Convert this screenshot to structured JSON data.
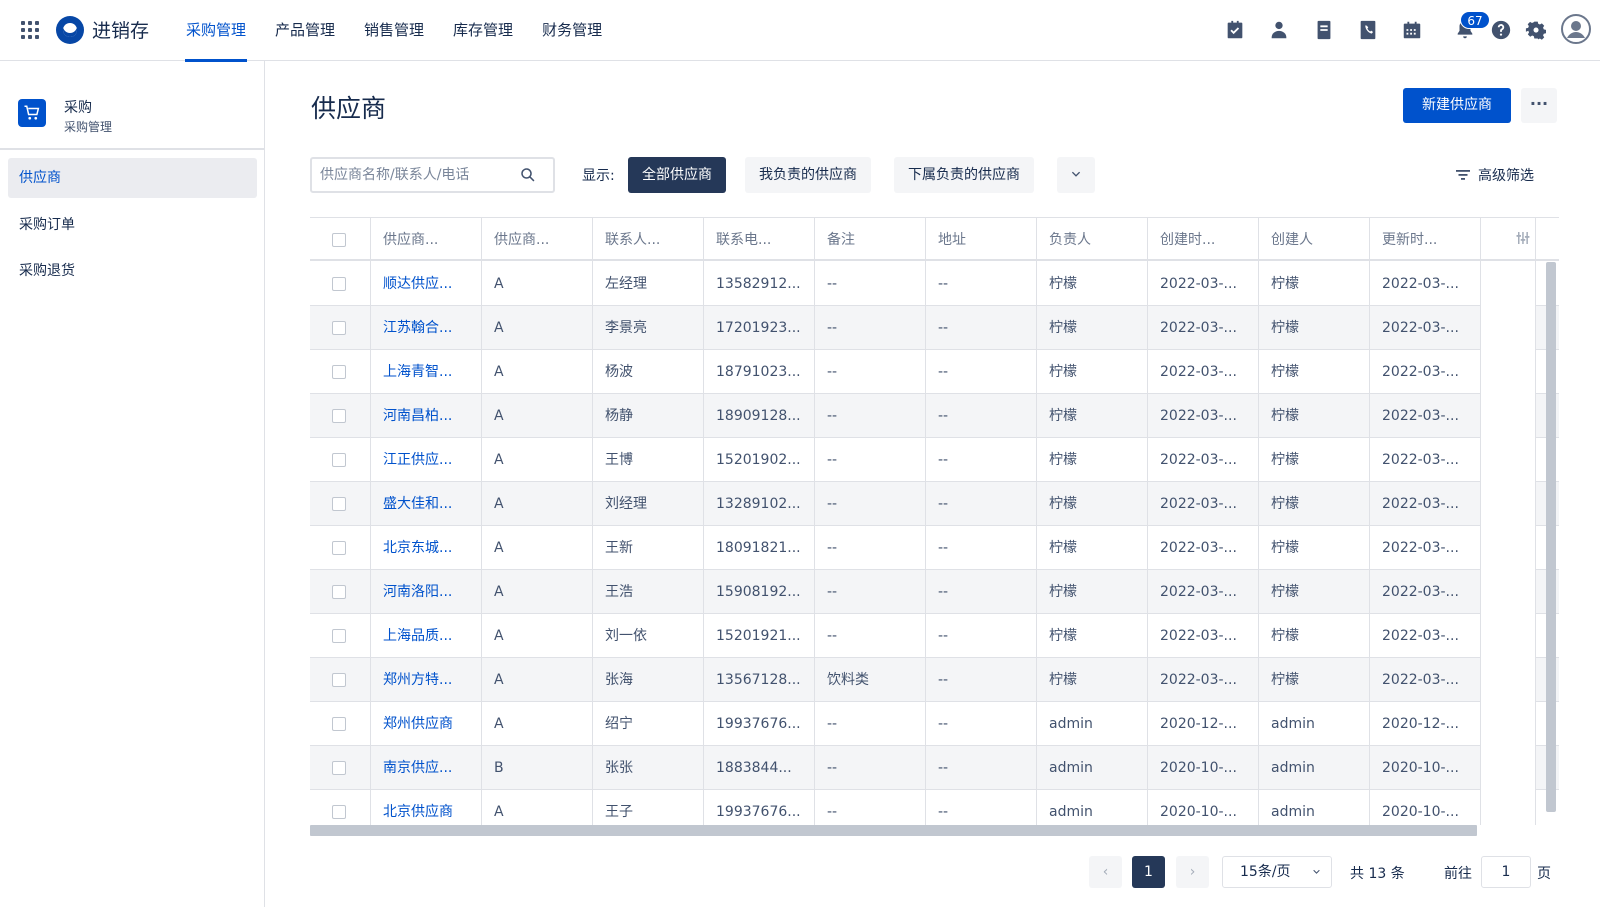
{
  "brand": "进销存",
  "nav": [
    "采购管理",
    "产品管理",
    "销售管理",
    "库存管理",
    "财务管理"
  ],
  "notifications_count": "67",
  "top_icons": [
    "task-check-icon",
    "contacts-icon",
    "document-icon",
    "phone-icon",
    "calendar-icon",
    "bell-icon",
    "help-icon",
    "settings-icon",
    "avatar-icon"
  ],
  "sidebar": {
    "title": "采购",
    "subtitle": "采购管理",
    "items": [
      "供应商",
      "采购订单",
      "采购退货"
    ]
  },
  "page": {
    "title": "供应商",
    "new_button": "新建供应商",
    "more_button": "···"
  },
  "filters": {
    "search_placeholder": "供应商名称/联系人/电话",
    "show_label": "显示:",
    "segments": [
      "全部供应商",
      "我负责的供应商",
      "下属负责的供应商"
    ],
    "advanced": "高级筛选"
  },
  "table": {
    "columns": [
      "供应商...",
      "供应商...",
      "联系人...",
      "联系电...",
      "备注",
      "地址",
      "负责人",
      "创建时...",
      "创建人",
      "更新时..."
    ],
    "rows": [
      [
        "顺达供应...",
        "A",
        "左经理",
        "13582912...",
        "--",
        "--",
        "柠檬",
        "2022-03-...",
        "柠檬",
        "2022-03-..."
      ],
      [
        "江苏翰合...",
        "A",
        "李景亮",
        "17201923...",
        "--",
        "--",
        "柠檬",
        "2022-03-...",
        "柠檬",
        "2022-03-..."
      ],
      [
        "上海青智...",
        "A",
        "杨波",
        "18791023...",
        "--",
        "--",
        "柠檬",
        "2022-03-...",
        "柠檬",
        "2022-03-..."
      ],
      [
        "河南昌柏...",
        "A",
        "杨静",
        "18909128...",
        "--",
        "--",
        "柠檬",
        "2022-03-...",
        "柠檬",
        "2022-03-..."
      ],
      [
        "江正供应...",
        "A",
        "王博",
        "15201902...",
        "--",
        "--",
        "柠檬",
        "2022-03-...",
        "柠檬",
        "2022-03-..."
      ],
      [
        "盛大佳和...",
        "A",
        "刘经理",
        "13289102...",
        "--",
        "--",
        "柠檬",
        "2022-03-...",
        "柠檬",
        "2022-03-..."
      ],
      [
        "北京东城...",
        "A",
        "王新",
        "18091821...",
        "--",
        "--",
        "柠檬",
        "2022-03-...",
        "柠檬",
        "2022-03-..."
      ],
      [
        "河南洛阳...",
        "A",
        "王浩",
        "15908192...",
        "--",
        "--",
        "柠檬",
        "2022-03-...",
        "柠檬",
        "2022-03-..."
      ],
      [
        "上海品质...",
        "A",
        "刘一依",
        "15201921...",
        "--",
        "--",
        "柠檬",
        "2022-03-...",
        "柠檬",
        "2022-03-..."
      ],
      [
        "郑州方特...",
        "A",
        "张海",
        "13567128...",
        "饮料类",
        "--",
        "柠檬",
        "2022-03-...",
        "柠檬",
        "2022-03-..."
      ],
      [
        "郑州供应商",
        "A",
        "绍宁",
        "19937676...",
        "--",
        "--",
        "admin",
        "2020-12-...",
        "admin",
        "2020-12-..."
      ],
      [
        "南京供应...",
        "B",
        "张张",
        "1883844...",
        "--",
        "--",
        "admin",
        "2020-10-...",
        "admin",
        "2020-10-..."
      ],
      [
        "北京供应商",
        "A",
        "王子",
        "19937676...",
        "--",
        "--",
        "admin",
        "2020-10-...",
        "admin",
        "2020-10-..."
      ]
    ]
  },
  "pagination": {
    "prev": "‹",
    "next": "›",
    "current": "1",
    "page_size": "15条/页",
    "total": "共 13 条",
    "goto_label": "前往",
    "goto_value": "1",
    "page_suffix": "页"
  },
  "colors": {
    "primary": "#0052cc",
    "dark": "#253858",
    "text": "#172b4d",
    "muted": "#42526e"
  }
}
